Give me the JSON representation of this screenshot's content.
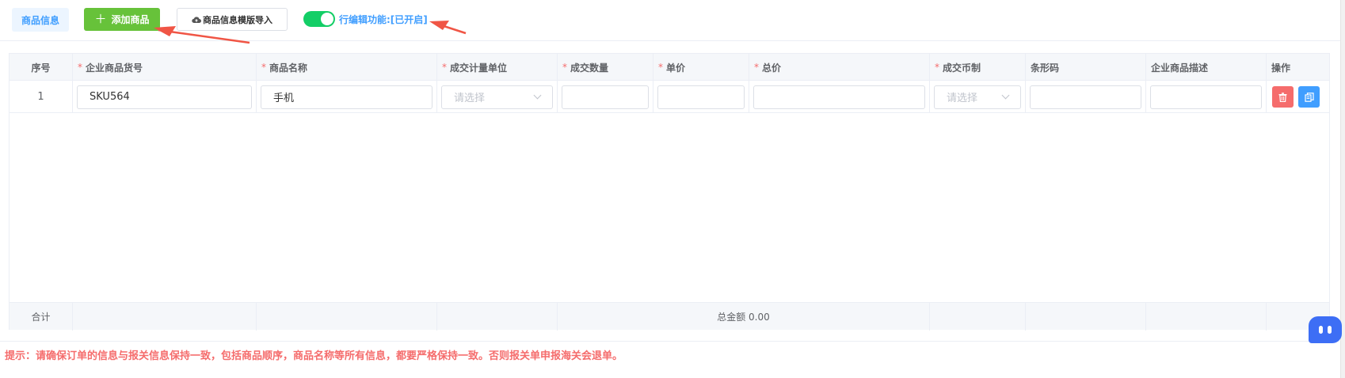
{
  "toolbar": {
    "tab_label": "商品信息",
    "add_label": "添加商品",
    "import_label": "商品信息模版导入",
    "row_edit_label": "行编辑功能:[已开启]",
    "row_edit_enabled": true
  },
  "table": {
    "columns": [
      {
        "label": "序号",
        "required": false
      },
      {
        "label": "企业商品货号",
        "required": true
      },
      {
        "label": "商品名称",
        "required": true
      },
      {
        "label": "成交计量单位",
        "required": true
      },
      {
        "label": "成交数量",
        "required": true
      },
      {
        "label": "单价",
        "required": true
      },
      {
        "label": "总价",
        "required": true
      },
      {
        "label": "成交币制",
        "required": true
      },
      {
        "label": "条形码",
        "required": false
      },
      {
        "label": "企业商品描述",
        "required": false
      },
      {
        "label": "操作",
        "required": false
      }
    ],
    "required_mark": "*",
    "rows": [
      {
        "index": "1",
        "sku": "SKU564",
        "name": "手机",
        "unit_placeholder": "请选择",
        "quantity": "",
        "unit_price": "",
        "total_price": "",
        "currency_placeholder": "请选择",
        "barcode": "",
        "description": ""
      }
    ],
    "footer": {
      "label": "合计",
      "total_amount": "总金额 0.00"
    }
  },
  "hint": "提示：请确保订单的信息与报关信息保持一致，包括商品顺序，商品名称等所有信息，都要严格保持一致。否则报关单申报海关会退单。",
  "colors": {
    "primary": "#409eff",
    "success": "#67c23a",
    "danger": "#f56c6c",
    "switch_on": "#13ce66",
    "annotation": "#f05545"
  }
}
